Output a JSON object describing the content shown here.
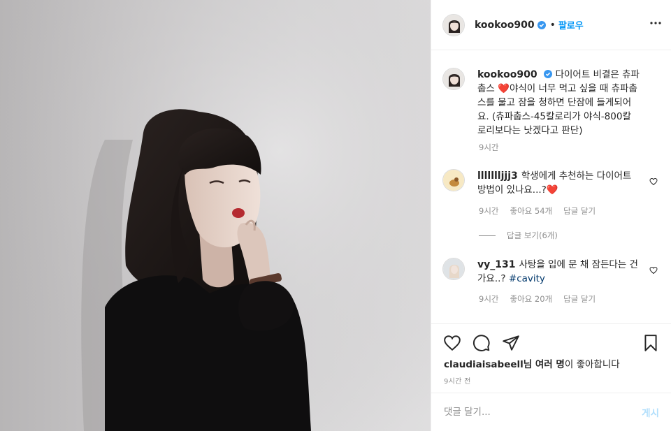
{
  "header": {
    "username": "kookoo900",
    "separator": "•",
    "follow_label": "팔로우"
  },
  "caption": {
    "username": "kookoo900",
    "text_1": "다이어트 비결은 츄파춥스",
    "heart": "❤️",
    "text_2": "야식이 너무 먹고 싶을 때 츄파춥스를 물고 잠을 청하면 단잠에 들게되어요. (츄파춥스-45칼로리가 야식-800칼로리보다는 낫겠다고 판단)",
    "time": "9시간"
  },
  "comments": [
    {
      "username": "llllllljjj3",
      "text": "학생에게 추천하는 다이어트 방법이 있나요...?",
      "heart": "❤️",
      "time": "9시간",
      "likes": "좋아요 54개",
      "reply": "답글 달기",
      "view_replies": "답글 보기(6개)"
    },
    {
      "username": "vy_131",
      "text": "사탕을 입에 문 채 잠든다는 건가요..?",
      "hashtag": "#cavity",
      "time": "9시간",
      "likes": "좋아요 20개",
      "reply": "답글 달기"
    }
  ],
  "footer": {
    "liked_user": "claudiaisabeell",
    "liked_suffix": "님 여러 명",
    "liked_tail": "이 좋아합니다",
    "time_ago": "9시간 전",
    "comment_placeholder": "댓글 달기...",
    "post_label": "게시"
  },
  "icons": {
    "verified": "verified-badge-icon",
    "more": "more-options-icon",
    "like": "heart-icon",
    "comment": "comment-icon",
    "share": "share-icon",
    "save": "bookmark-icon"
  },
  "colors": {
    "accent": "#0095f6",
    "verified": "#3897f0",
    "heart": "#ed4956",
    "muted": "#8e8e8e",
    "post_disabled": "#b2dffc"
  }
}
